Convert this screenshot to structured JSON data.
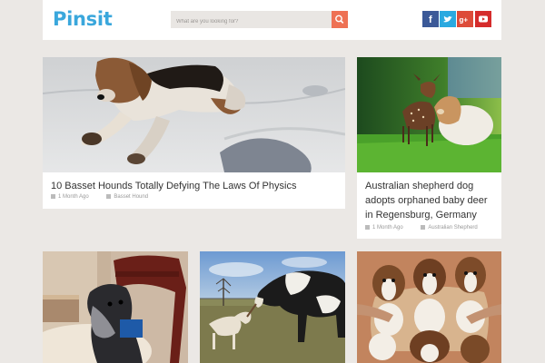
{
  "header": {
    "logo": "Pinsit",
    "search_placeholder": "What are you looking for?",
    "social": [
      "facebook-icon",
      "twitter-icon",
      "google-plus-icon",
      "youtube-icon"
    ]
  },
  "posts": [
    {
      "title": "10 Basset Hounds Totally Defying The Laws Of Physics",
      "date": "1 Month Ago",
      "tag": "Basset Hound"
    },
    {
      "title": "Australian shepherd dog adopts orphaned baby deer in Regensburg, Germany",
      "date": "1 Month Ago",
      "tag": "Australian Shepherd"
    }
  ],
  "colors": {
    "brand": "#3aa7dc",
    "search_button": "#ee7154",
    "facebook": "#3b5998",
    "twitter": "#2aa9e0",
    "google_plus": "#dd4b39",
    "youtube": "#d52b2b"
  }
}
